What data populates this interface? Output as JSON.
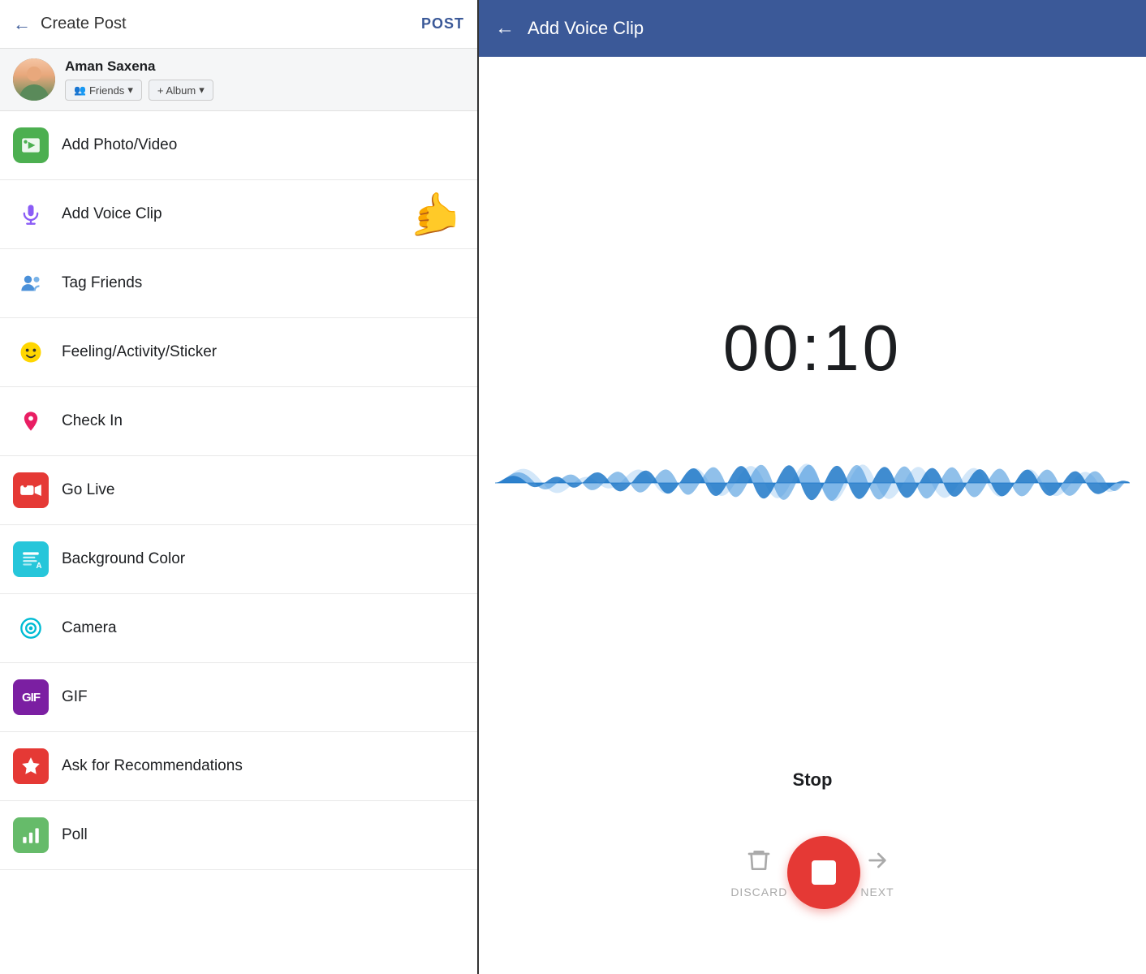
{
  "left": {
    "header": {
      "back_label": "←",
      "title": "Create Post",
      "post_label": "POST"
    },
    "user": {
      "name": "Aman Saxena",
      "friends_label": "Friends",
      "album_label": "+ Album"
    },
    "menu_items": [
      {
        "id": "add-photo-video",
        "label": "Add Photo/Video",
        "icon_type": "photo",
        "icon_bg": "#4CAF50"
      },
      {
        "id": "add-voice-clip",
        "label": "Add Voice Clip",
        "icon_type": "mic",
        "icon_bg": "white",
        "has_pointer": true
      },
      {
        "id": "tag-friends",
        "label": "Tag Friends",
        "icon_type": "tag",
        "icon_bg": "white"
      },
      {
        "id": "feeling-activity",
        "label": "Feeling/Activity/Sticker",
        "icon_type": "feeling",
        "icon_bg": "white"
      },
      {
        "id": "check-in",
        "label": "Check In",
        "icon_type": "location",
        "icon_bg": "white"
      },
      {
        "id": "go-live",
        "label": "Go Live",
        "icon_type": "live",
        "icon_bg": "#E53935"
      },
      {
        "id": "background-color",
        "label": "Background Color",
        "icon_type": "bg-color",
        "icon_bg": "#26C6DA"
      },
      {
        "id": "camera",
        "label": "Camera",
        "icon_type": "camera",
        "icon_bg": "white"
      },
      {
        "id": "gif",
        "label": "GIF",
        "icon_type": "gif",
        "icon_bg": "#7B1FA2"
      },
      {
        "id": "ask-recommendations",
        "label": "Ask for Recommendations",
        "icon_type": "recommend",
        "icon_bg": "#E53935"
      },
      {
        "id": "poll",
        "label": "Poll",
        "icon_type": "poll",
        "icon_bg": "#66BB6A"
      }
    ]
  },
  "right": {
    "header": {
      "back_label": "←",
      "title": "Add Voice Clip"
    },
    "timer": "00:10",
    "stop_label": "Stop",
    "discard_label": "DISCARD",
    "next_label": "NEXT"
  }
}
